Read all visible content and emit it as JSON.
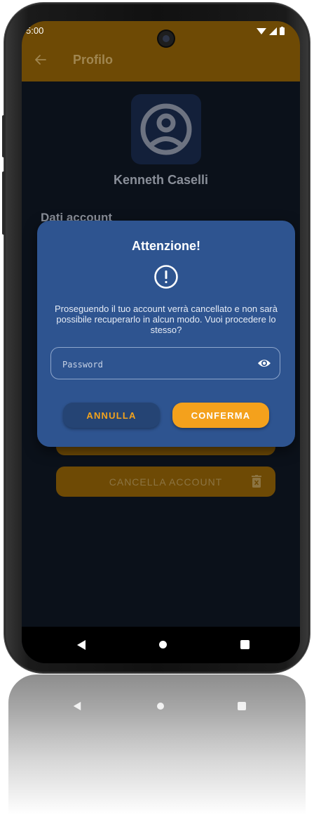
{
  "status_bar": {
    "time": "5:00"
  },
  "app_bar": {
    "title": "Profilo"
  },
  "profile": {
    "user_name": "Kenneth Caselli",
    "section_title": "Dati account",
    "delete_button_label": "CANCELLA ACCOUNT"
  },
  "dialog": {
    "title": "Attenzione!",
    "message": "Proseguendo il tuo account verrà cancellato e non sarà possibile recuperarlo in alcun modo. Vuoi procedere lo stesso?",
    "password_placeholder": "Password",
    "cancel_label": "ANNULLA",
    "confirm_label": "CONFERMA"
  },
  "colors": {
    "app_bar": "#6e4a05",
    "dialog_background": "#2e5490",
    "accent": "#f4a11c",
    "screen_background": "#0b111a"
  },
  "icons": [
    "back-arrow-icon",
    "user-avatar-icon",
    "alert-circle-icon",
    "eye-icon",
    "trash-icon",
    "nav-back-icon",
    "nav-home-icon",
    "nav-recents-icon"
  ]
}
